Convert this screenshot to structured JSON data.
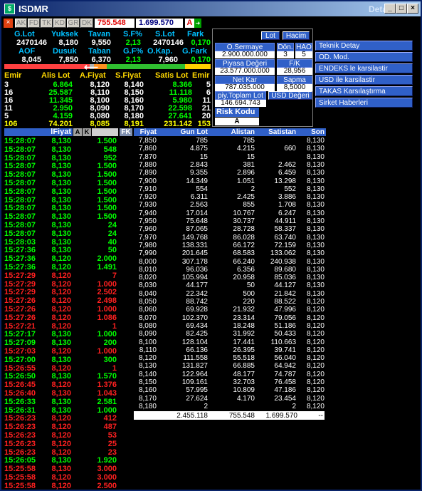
{
  "window": {
    "title": "ISDMR",
    "title_right": "Detay",
    "min_label": "_",
    "max_label": "□",
    "close_label": "×"
  },
  "toolbar": {
    "close_label": "×",
    "tabs": [
      "AK",
      "FD",
      "TK",
      "KD",
      "GR",
      "DK"
    ],
    "value1": "755.548",
    "value2": "1.699.570",
    "a_label": "A",
    "arrow_label": "➜"
  },
  "summary1": {
    "headers": [
      "G.Lot",
      "Yuksek",
      "Tavan",
      "S.F%",
      "S.Lot",
      "Fark"
    ],
    "values": [
      "2470146",
      "8,180",
      "9,550",
      "2,13",
      "2470146",
      "0,170"
    ]
  },
  "summary2": {
    "headers": [
      "AOF",
      "Dusuk",
      "Taban",
      "G.F%",
      "O.Kap.",
      "G.Fark"
    ],
    "values": [
      "8,045",
      "7,850",
      "6,370",
      "2,13",
      "7,960",
      "0,170"
    ]
  },
  "colors": {
    "bar_red": "#ff4040",
    "bar_yellow": "#ffd000",
    "bar_green": "#30c030",
    "bar_orange": "#ff9020",
    "bar_gray": "#b0b0b0"
  },
  "book": {
    "headers": [
      "Emir",
      "Alis Lot",
      "A.Fiyat",
      "S.Fiyat",
      "Satis Lot",
      "Emir"
    ],
    "rows": [
      [
        "3",
        "6.864",
        "8,120",
        "8,140",
        "8.366",
        "5"
      ],
      [
        "16",
        "25.587",
        "8,110",
        "8,150",
        "11.118",
        "6"
      ],
      [
        "16",
        "11.345",
        "8,100",
        "8,160",
        "5.980",
        "11"
      ],
      [
        "11",
        "2.950",
        "8,090",
        "8,170",
        "22.598",
        "21"
      ],
      [
        "5",
        "4.159",
        "8,080",
        "8,180",
        "27.641",
        "20"
      ]
    ],
    "totals": [
      "106",
      "74.201",
      "8,085",
      "8,191",
      "231.142",
      "153"
    ]
  },
  "mid": {
    "lot_btn": "Lot",
    "hacim_btn": "Hacim",
    "osermaye_label": "O.Sermaye",
    "osermaye_value": "2.900.000.000",
    "don_label": "Dön.",
    "don_value": "3",
    "hao_label": "HAO",
    "hao_value": "5",
    "piyasa_label": "Piyasa Değeri",
    "piyasa_value": "23.577.000.000",
    "fk_label": "F/K",
    "fk_value": "28,956",
    "netkar_label": "Net Kar",
    "netkar_value": "787.035.000",
    "sapma_label": "Sapma",
    "sapma_value": "8,5000",
    "piyt_label": "piy.Toplam Lot",
    "piyt_value": "146.694.743",
    "usd_label": "USD Değeri",
    "risk_label": "Risk Kodu",
    "risk_value": "A"
  },
  "right_buttons": [
    "Teknik Detay",
    "OD. Mod.",
    "ENDEKS le karsilastir",
    "USD ile karsilastir",
    "TAKAS Karsılaştırma",
    "Sirket Haberleri"
  ],
  "trades": {
    "headers": {
      "fiyat": "lFiyat",
      "a": "A",
      "k": "K",
      "fk": "FK"
    },
    "rows": [
      [
        "15:28:07",
        "8,130",
        "1.500",
        "g"
      ],
      [
        "15:28:07",
        "8,130",
        "548",
        "g"
      ],
      [
        "15:28:07",
        "8,130",
        "952",
        "g"
      ],
      [
        "15:28:07",
        "8,130",
        "1.500",
        "g"
      ],
      [
        "15:28:07",
        "8,130",
        "1.500",
        "g"
      ],
      [
        "15:28:07",
        "8,130",
        "1.500",
        "g"
      ],
      [
        "15:28:07",
        "8,130",
        "1.500",
        "g"
      ],
      [
        "15:28:07",
        "8,130",
        "1.500",
        "g"
      ],
      [
        "15:28:07",
        "8,130",
        "1.500",
        "g"
      ],
      [
        "15:28:07",
        "8,130",
        "1.500",
        "g"
      ],
      [
        "15:28:07",
        "8,130",
        "24",
        "g"
      ],
      [
        "15:28:07",
        "8,130",
        "24",
        "g"
      ],
      [
        "15:28:03",
        "8,130",
        "40",
        "g"
      ],
      [
        "15:27:36",
        "8,130",
        "50",
        "g"
      ],
      [
        "15:27:36",
        "8,120",
        "2.000",
        "g"
      ],
      [
        "15:27:36",
        "8,120",
        "1.491",
        "g"
      ],
      [
        "15:27:29",
        "8,120",
        "7",
        "r"
      ],
      [
        "15:27:29",
        "8,120",
        "1.000",
        "r"
      ],
      [
        "15:27:29",
        "8,120",
        "2.502",
        "r"
      ],
      [
        "15:27:26",
        "8,120",
        "2.498",
        "r"
      ],
      [
        "15:27:26",
        "8,120",
        "1.000",
        "r"
      ],
      [
        "15:27:26",
        "8,120",
        "1.086",
        "r"
      ],
      [
        "15:27:21",
        "8,120",
        "1",
        "r"
      ],
      [
        "15:27:17",
        "8,130",
        "1.000",
        "g"
      ],
      [
        "15:27:09",
        "8,130",
        "200",
        "g"
      ],
      [
        "15:27:03",
        "8,120",
        "1.000",
        "r"
      ],
      [
        "15:27:00",
        "8,130",
        "300",
        "g"
      ],
      [
        "15:26:55",
        "8,120",
        "1",
        "r"
      ],
      [
        "15:26:50",
        "8,130",
        "1.570",
        "g"
      ],
      [
        "15:26:45",
        "8,120",
        "1.376",
        "r"
      ],
      [
        "15:26:40",
        "8,130",
        "1.043",
        "r"
      ],
      [
        "15:26:33",
        "8,130",
        "2.581",
        "g"
      ],
      [
        "15:26:31",
        "8,130",
        "1.000",
        "g"
      ],
      [
        "15:26:23",
        "8,120",
        "412",
        "r"
      ],
      [
        "15:26:23",
        "8,120",
        "487",
        "r"
      ],
      [
        "15:26:23",
        "8,120",
        "53",
        "r"
      ],
      [
        "15:26:23",
        "8,120",
        "25",
        "r"
      ],
      [
        "15:26:23",
        "8,120",
        "23",
        "r"
      ],
      [
        "15:26:05",
        "8,130",
        "1.920",
        "g"
      ],
      [
        "15:25:58",
        "8,130",
        "3.000",
        "r"
      ],
      [
        "15:25:58",
        "8,120",
        "3.000",
        "r"
      ],
      [
        "15:25:58",
        "8,120",
        "2.500",
        "r"
      ]
    ]
  },
  "depth": {
    "headers": [
      "Fiyat",
      "Gun Lot",
      "Alistan",
      "Satistan",
      "Son"
    ],
    "rows": [
      [
        "7,850",
        "785",
        "785",
        "",
        "8,130"
      ],
      [
        "7,860",
        "4.875",
        "4.215",
        "660",
        "8,130"
      ],
      [
        "7,870",
        "15",
        "15",
        "",
        "8,130"
      ],
      [
        "7,880",
        "2.843",
        "381",
        "2.462",
        "8,130"
      ],
      [
        "7,890",
        "9.355",
        "2.896",
        "6.459",
        "8,130"
      ],
      [
        "7,900",
        "14.349",
        "1.051",
        "13.298",
        "8,130"
      ],
      [
        "7,910",
        "554",
        "2",
        "552",
        "8,130"
      ],
      [
        "7,920",
        "6.311",
        "2.425",
        "3.886",
        "8,130"
      ],
      [
        "7,930",
        "2.563",
        "855",
        "1.708",
        "8,130"
      ],
      [
        "7,940",
        "17.014",
        "10.767",
        "6.247",
        "8,130"
      ],
      [
        "7,950",
        "75.648",
        "30.737",
        "44.911",
        "8,130"
      ],
      [
        "7,960",
        "87.065",
        "28.728",
        "58.337",
        "8,130"
      ],
      [
        "7,970",
        "149.768",
        "86.028",
        "63.740",
        "8,130"
      ],
      [
        "7,980",
        "138.331",
        "66.172",
        "72.159",
        "8,130"
      ],
      [
        "7,990",
        "201.645",
        "68.583",
        "133.062",
        "8,130"
      ],
      [
        "8,000",
        "307.178",
        "66.240",
        "240.938",
        "8,130"
      ],
      [
        "8,010",
        "96.036",
        "6.356",
        "89.680",
        "8,130"
      ],
      [
        "8,020",
        "105.994",
        "20.958",
        "85.036",
        "8,130"
      ],
      [
        "8,030",
        "44.177",
        "50",
        "44.127",
        "8,130"
      ],
      [
        "8,040",
        "22.342",
        "500",
        "21.842",
        "8,130"
      ],
      [
        "8,050",
        "88.742",
        "220",
        "88.522",
        "8,120"
      ],
      [
        "8,060",
        "69.928",
        "21.932",
        "47.996",
        "8,120"
      ],
      [
        "8,070",
        "102.370",
        "23.314",
        "79.056",
        "8,120"
      ],
      [
        "8,080",
        "69.434",
        "18.248",
        "51.186",
        "8,120"
      ],
      [
        "8,090",
        "82.425",
        "31.992",
        "50.433",
        "8,120"
      ],
      [
        "8,100",
        "128.104",
        "17.441",
        "110.663",
        "8,120"
      ],
      [
        "8,110",
        "66.136",
        "26.395",
        "39.741",
        "8,120"
      ],
      [
        "8,120",
        "111.558",
        "55.518",
        "56.040",
        "8,120"
      ],
      [
        "8,130",
        "131.827",
        "66.885",
        "64.942",
        "8,120"
      ],
      [
        "8,140",
        "122.964",
        "48.177",
        "74.787",
        "8,120"
      ],
      [
        "8,150",
        "109.161",
        "32.703",
        "76.458",
        "8,120"
      ],
      [
        "8,160",
        "57.995",
        "10.809",
        "47.186",
        "8,120"
      ],
      [
        "8,170",
        "27.624",
        "4.170",
        "23.454",
        "8,120"
      ],
      [
        "8,180",
        "2",
        "",
        "2",
        "8,120"
      ],
      [
        "",
        "",
        "",
        "",
        "8,120"
      ]
    ],
    "totals": [
      "",
      "2.455.118",
      "755.548",
      "1.699.570",
      "--"
    ]
  }
}
